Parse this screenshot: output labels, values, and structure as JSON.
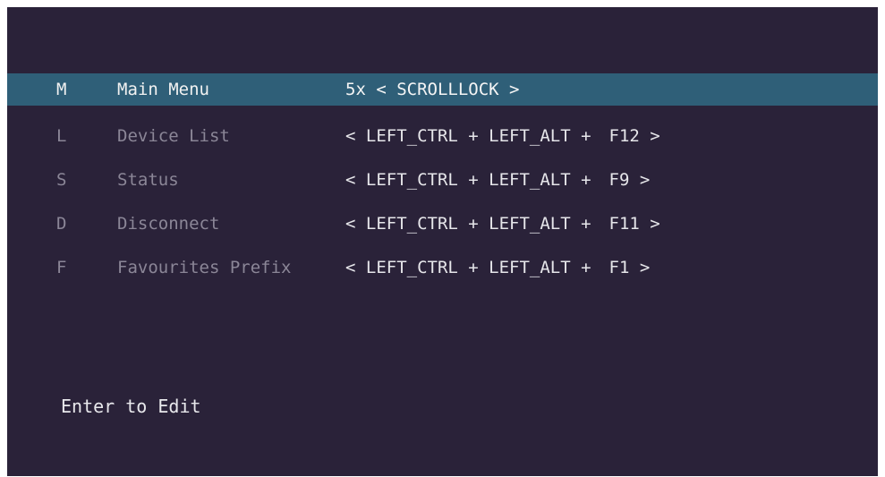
{
  "menu": {
    "items": [
      {
        "key": "M",
        "label": "Main Menu",
        "hotkey_main": "5x < SCROLLLOCK >",
        "hotkey_suffix": "",
        "selected": true
      },
      {
        "key": "L",
        "label": "Device List",
        "hotkey_main": "< LEFT_CTRL + LEFT_ALT +",
        "hotkey_suffix": "F12 >",
        "selected": false
      },
      {
        "key": "S",
        "label": "Status",
        "hotkey_main": "< LEFT_CTRL + LEFT_ALT +",
        "hotkey_suffix": "F9 >",
        "selected": false
      },
      {
        "key": "D",
        "label": "Disconnect",
        "hotkey_main": "< LEFT_CTRL + LEFT_ALT +",
        "hotkey_suffix": "F11 >",
        "selected": false
      },
      {
        "key": "F",
        "label": "Favourites Prefix",
        "hotkey_main": "< LEFT_CTRL + LEFT_ALT +",
        "hotkey_suffix": "F1 >",
        "selected": false
      }
    ]
  },
  "footer": {
    "hint": "Enter to Edit"
  },
  "colors": {
    "background": "#2a2239",
    "selected_row": "#2f5f78",
    "dim_text": "#8b8697",
    "bright_text": "#e6e6ea"
  }
}
